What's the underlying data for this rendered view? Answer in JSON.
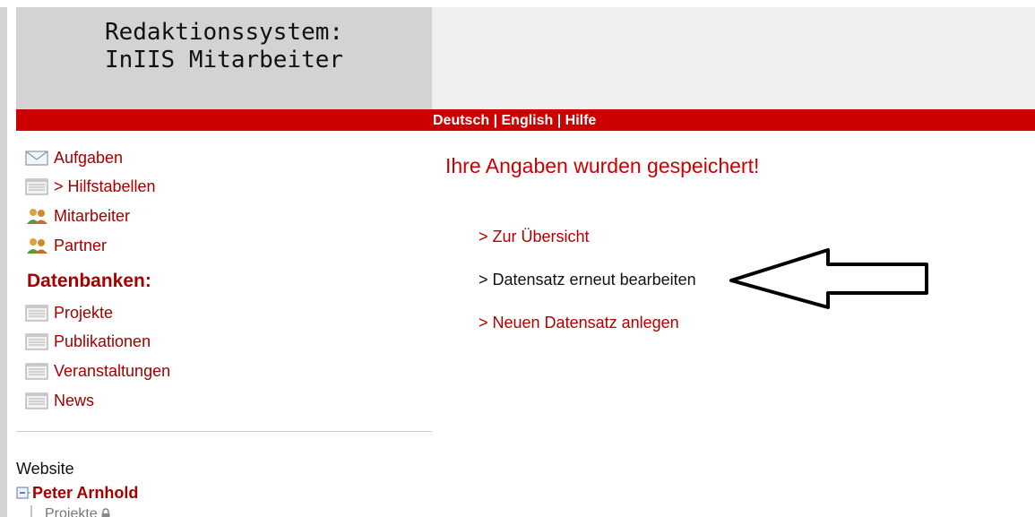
{
  "header": {
    "title_line1": "Redaktionssystem:",
    "title_line2": "InIIS Mitarbeiter"
  },
  "langbar": {
    "deutsch": "Deutsch",
    "english": "English",
    "hilfe": "Hilfe",
    "separator": " | "
  },
  "sidebar": {
    "items": [
      {
        "label": "Aufgaben",
        "icon": "envelope-icon"
      },
      {
        "label": "> Hilfstabellen",
        "icon": "table-icon"
      },
      {
        "label": "Mitarbeiter",
        "icon": "users-icon"
      },
      {
        "label": "Partner",
        "icon": "users-icon"
      }
    ],
    "db_heading": "Datenbanken:",
    "db_items": [
      {
        "label": "Projekte",
        "icon": "table-icon"
      },
      {
        "label": "Publikationen",
        "icon": "table-icon"
      },
      {
        "label": "Veranstaltungen",
        "icon": "table-icon"
      },
      {
        "label": "News",
        "icon": "table-icon"
      }
    ]
  },
  "tree": {
    "website_label": "Website",
    "root_label": "Peter Arnhold",
    "child_label": "Projekte"
  },
  "main": {
    "message": "Ihre Angaben wurden gespeichert!",
    "links": [
      {
        "label": "> Zur Übersicht"
      },
      {
        "label": "> Datensatz erneut bearbeiten"
      },
      {
        "label": "> Neuen Datensatz anlegen"
      }
    ]
  },
  "colors": {
    "accent_red": "#cc0000",
    "link_red": "#a50000",
    "header_gray": "#d3d3d3"
  }
}
